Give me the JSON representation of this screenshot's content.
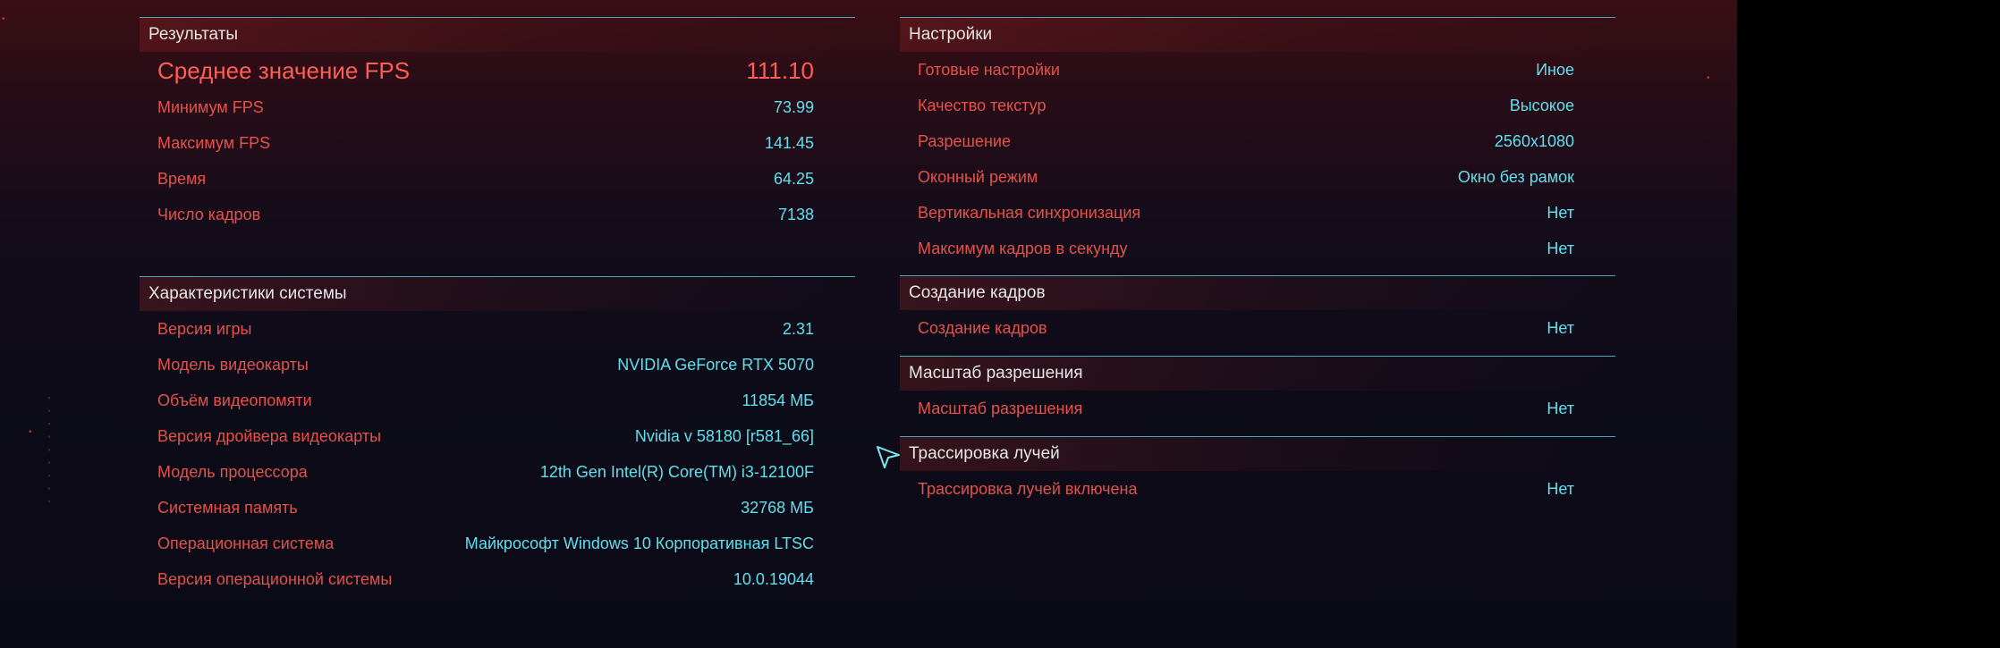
{
  "results": {
    "title": "Результаты",
    "avg_fps_label": "Среднее значение FPS",
    "avg_fps_value": "111.10",
    "rows": [
      {
        "label": "Минимум FPS",
        "value": "73.99"
      },
      {
        "label": "Максимум FPS",
        "value": "141.45"
      },
      {
        "label": "Время",
        "value": "64.25"
      },
      {
        "label": "Число кадров",
        "value": "7138"
      }
    ]
  },
  "system": {
    "title": "Характеристики системы",
    "rows": [
      {
        "label": "Версия игры",
        "value": "2.31"
      },
      {
        "label": "Модель видеокарты",
        "value": "NVIDIA GeForce RTX 5070"
      },
      {
        "label": "Объём видеопомяти",
        "value": "11854 МБ"
      },
      {
        "label": "Версия дройвера видеокарты",
        "value": "Nvidia v 58180 [r581_66]"
      },
      {
        "label": "Модель процессора",
        "value": "12th Gen Intel(R) Core(TM) i3-12100F"
      },
      {
        "label": "Системная память",
        "value": "32768 МБ"
      },
      {
        "label": "Операционная система",
        "value": "Майкрософт Windows 10 Корпоративная LTSC"
      },
      {
        "label": "Версия операционной системы",
        "value": "10.0.19044"
      }
    ]
  },
  "settings": {
    "title": "Настройки",
    "rows": [
      {
        "label": "Готовые настройки",
        "value": "Иное"
      },
      {
        "label": "Качество текстур",
        "value": "Высокое"
      },
      {
        "label": "Разрешение",
        "value": "2560x1080"
      },
      {
        "label": "Оконный режим",
        "value": "Окно без рамок"
      },
      {
        "label": "Вертикальная синхронизация",
        "value": "Нет"
      },
      {
        "label": "Максимум кадров в секунду",
        "value": "Нет"
      }
    ]
  },
  "frame_gen": {
    "title": "Создание кадров",
    "rows": [
      {
        "label": "Создание кадров",
        "value": "Нет"
      }
    ]
  },
  "resolution_scaling": {
    "title": "Масштаб разрешения",
    "rows": [
      {
        "label": "Масштаб разрешения",
        "value": "Нет"
      }
    ]
  },
  "ray_tracing": {
    "title": "Трассировка лучей",
    "rows": [
      {
        "label": "Трассировка лучей включена",
        "value": "Нет"
      }
    ]
  },
  "colors": {
    "label_red": "#e4524a",
    "value_cyan": "#5fe0ee",
    "divider_cyan": "#4aa9b8",
    "highlight_red": "#ff5d55"
  },
  "icons": {
    "cursor": "pointer-cursor-icon"
  }
}
